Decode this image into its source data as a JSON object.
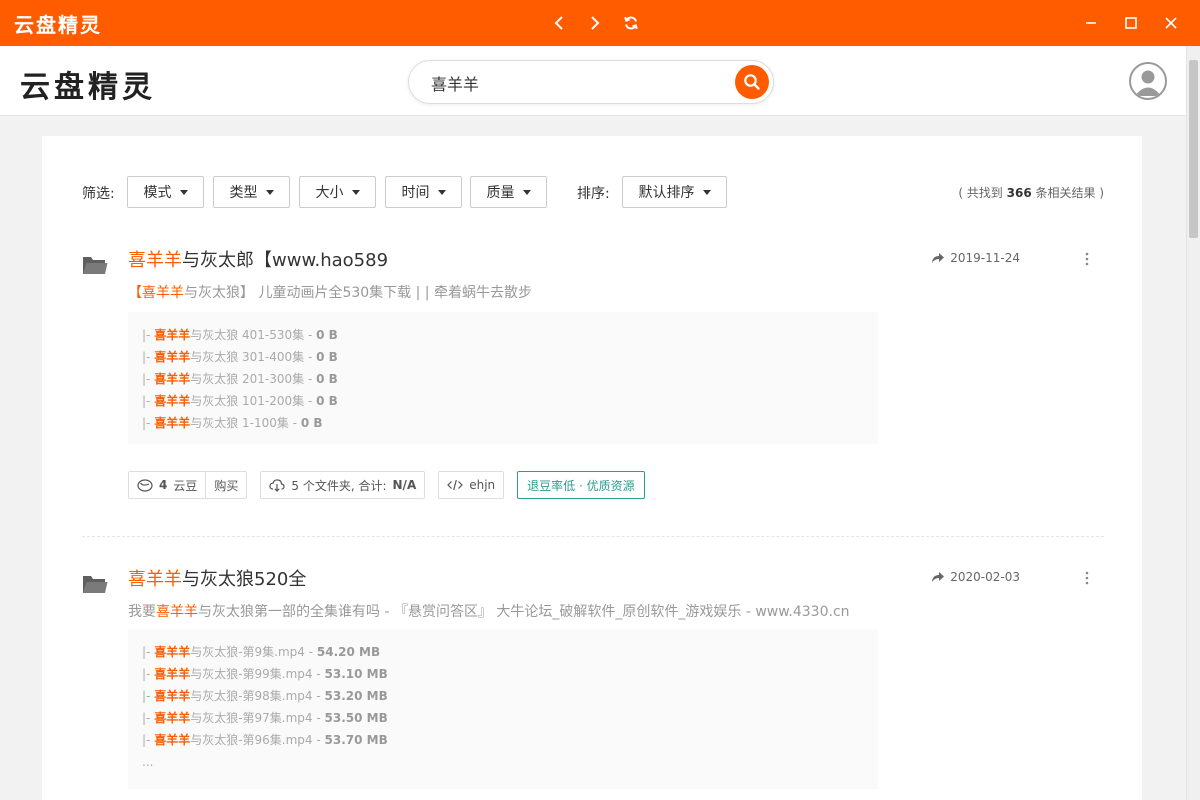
{
  "titlebar": {
    "app_name": "云盘精灵"
  },
  "header": {
    "logo": "云盘精灵"
  },
  "search": {
    "value": "喜羊羊"
  },
  "filters": {
    "label": "筛选:",
    "items": [
      "模式",
      "类型",
      "大小",
      "时间",
      "质量"
    ],
    "sort_label": "排序:",
    "sort_value": "默认排序",
    "count_prefix": "( 共找到 ",
    "count": "366",
    "count_suffix": " 条相关结果 )"
  },
  "results": [
    {
      "title_hl": "喜羊羊",
      "title_rest": "与灰太郎【www.hao589",
      "date": "2019-11-24",
      "desc_parts": [
        "【",
        "喜羊羊",
        "与灰太狼】 儿童动画片全530集下载 | | 牵着蜗牛去散步"
      ],
      "files": [
        {
          "prefix": "|- ",
          "hl": "喜羊羊",
          "name": "与灰太狼 401-530集",
          "sep": " - ",
          "size": "0 B"
        },
        {
          "prefix": "|- ",
          "hl": "喜羊羊",
          "name": "与灰太狼 301-400集",
          "sep": " - ",
          "size": "0 B"
        },
        {
          "prefix": "|- ",
          "hl": "喜羊羊",
          "name": "与灰太狼 201-300集",
          "sep": " - ",
          "size": "0 B"
        },
        {
          "prefix": "|- ",
          "hl": "喜羊羊",
          "name": "与灰太狼 101-200集",
          "sep": " - ",
          "size": "0 B"
        },
        {
          "prefix": "|- ",
          "hl": "喜羊羊",
          "name": "与灰太狼 1-100集",
          "sep": " - ",
          "size": "0 B"
        }
      ],
      "tags": {
        "beans_count": "4",
        "beans_unit": "云豆",
        "buy": "购买",
        "folders_text": "5 个文件夹, 合计: ",
        "folders_total": "N/A",
        "code": "ehjn",
        "quality": "退豆率低 · 优质资源"
      }
    },
    {
      "title_hl": "喜羊羊",
      "title_rest": "与灰太狼520全",
      "date": "2020-02-03",
      "desc_parts": [
        "我要",
        "喜羊羊",
        "与灰太狼第一部的全集谁有吗 - 『悬赏问答区』 大牛论坛_破解软件_原创软件_游戏娱乐 - www.4330.cn"
      ],
      "files": [
        {
          "prefix": "|- ",
          "hl": "喜羊羊",
          "name": "与灰太狼-第9集.mp4",
          "sep": " - ",
          "size": "54.20 MB"
        },
        {
          "prefix": "|- ",
          "hl": "喜羊羊",
          "name": "与灰太狼-第99集.mp4",
          "sep": " - ",
          "size": "53.10 MB"
        },
        {
          "prefix": "|- ",
          "hl": "喜羊羊",
          "name": "与灰太狼-第98集.mp4",
          "sep": " - ",
          "size": "53.20 MB"
        },
        {
          "prefix": "|- ",
          "hl": "喜羊羊",
          "name": "与灰太狼-第97集.mp4",
          "sep": " - ",
          "size": "53.50 MB"
        },
        {
          "prefix": "|- ",
          "hl": "喜羊羊",
          "name": "与灰太狼-第96集.mp4",
          "sep": " - ",
          "size": "53.70 MB"
        }
      ],
      "more": "..."
    }
  ],
  "colors": {
    "accent": "#ff5c00",
    "green": "#2a9d8f"
  },
  "icons": [
    "back-icon",
    "forward-icon",
    "refresh-icon",
    "minimize-icon",
    "maximize-icon",
    "close-icon",
    "search-icon",
    "avatar-icon",
    "folder-icon",
    "share-arrow-icon",
    "more-vertical-icon",
    "bean-icon",
    "cloud-icon",
    "code-icon"
  ]
}
